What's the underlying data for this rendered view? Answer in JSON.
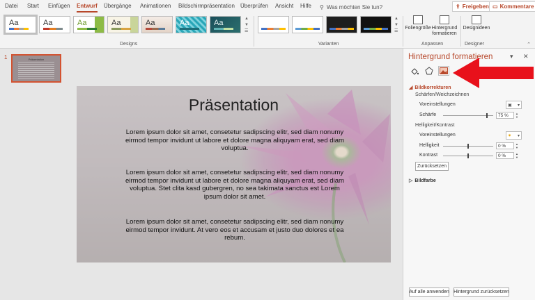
{
  "tabs": [
    "Datei",
    "Start",
    "Einfügen",
    "Entwurf",
    "Übergänge",
    "Animationen",
    "Bildschirmpräsentation",
    "Überprüfen",
    "Ansicht",
    "Hilfe"
  ],
  "search": {
    "placeholder": "Was möchten Sie tun?"
  },
  "top_buttons": {
    "share": "Freigeben",
    "comments": "Kommentare"
  },
  "ribbon": {
    "theme_label": "Aa",
    "groups": {
      "designs": "Designs",
      "variants": "Varianten",
      "adjust": "Anpassen",
      "designer": "Designer"
    },
    "buttons": {
      "slide_size": "Foliengröße",
      "background": "Hintergrund formatieren",
      "design_ideas": "Designideen"
    }
  },
  "thumbnails": [
    {
      "number": "1"
    }
  ],
  "slide": {
    "title": "Präsentation",
    "paragraphs": [
      "Lorem ipsum dolor sit amet, consetetur sadipscing elitr, sed diam nonumy eirmod tempor invidunt ut labore et dolore magna aliquyam erat, sed diam voluptua.",
      "Lorem ipsum dolor sit amet, consetetur sadipscing elitr, sed diam nonumy eirmod tempor invidunt ut labore et dolore magna aliquyam erat, sed diam voluptua. Stet clita kasd gubergren, no sea takimata sanctus est Lorem ipsum dolor sit amet.",
      "Lorem ipsum dolor sit amet, consetetur sadipscing elitr, sed diam nonumy eirmod tempor invidunt. At vero eos et accusam et justo duo dolores et ea rebum."
    ]
  },
  "format_pane": {
    "title": "Hintergrund formatieren",
    "section_picture_corrections": "Bildkorrekturen",
    "sharpen_soften": "Schärfen/Weichzeichnen",
    "presets_label": "Voreinstellungen",
    "sharpness_label": "Schärfe",
    "sharpness_value": "75 %",
    "brightness_contrast": "Helligkeit/Kontrast",
    "presets_label2": "Voreinstellungen",
    "brightness_label": "Helligkeit",
    "brightness_value": "0 %",
    "contrast_label": "Kontrast",
    "contrast_value": "0 %",
    "reset_button": "Zurücksetzen",
    "section_picture_color": "Bildfarbe",
    "apply_all_button": "Auf alle anwenden",
    "reset_background_button": "Hintergrund zurücksetzen"
  },
  "colors": {
    "accent": "#b7472a",
    "arrow": "#e8111b"
  }
}
